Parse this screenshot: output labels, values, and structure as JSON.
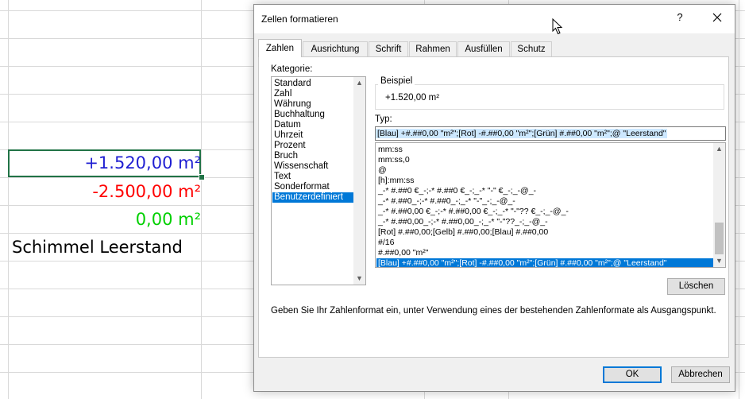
{
  "sheet": {
    "cells": [
      {
        "text": "+1.520,00 m²",
        "color": "#1f1fd2"
      },
      {
        "text": "-2.500,00 m²",
        "color": "#ff0000"
      },
      {
        "text": "0,00 m²",
        "color": "#00d000"
      },
      {
        "text": "Schimmel Leerstand",
        "color": "#000000"
      }
    ],
    "gridline_color": "#d9d9d9",
    "active_cell_border": "#217346"
  },
  "dialog": {
    "title": "Zellen formatieren",
    "help": "?",
    "tabs": [
      "Zahlen",
      "Ausrichtung",
      "Schrift",
      "Rahmen",
      "Ausfüllen",
      "Schutz"
    ],
    "active_tab": "Zahlen",
    "kategorie_label": "Kategorie:",
    "categories": [
      "Standard",
      "Zahl",
      "Währung",
      "Buchhaltung",
      "Datum",
      "Uhrzeit",
      "Prozent",
      "Bruch",
      "Wissenschaft",
      "Text",
      "Sonderformat",
      "Benutzerdefiniert"
    ],
    "selected_category": "Benutzerdefiniert",
    "beispiel_label": "Beispiel",
    "beispiel_value": "+1.520,00 m²",
    "typ_label": "Typ:",
    "typ_value": "[Blau] +#.##0,00 \"m²\";[Rot] -#.##0,00 \"m²\";[Grün] #.##0,00 \"m²\";@ \"Leerstand\"",
    "formats": [
      "mm:ss",
      "mm:ss,0",
      "@",
      "[h]:mm:ss",
      "_-* #.##0 €_-;-* #.##0 €_-;_-* \"-\" €_-;_-@_-",
      "_-* #.##0_-;-* #.##0_-;_-* \"-\"_-;_-@_-",
      "_-* #.##0,00 €_-;-* #.##0,00 €_-;_-* \"-\"?? €_-;_-@_-",
      "_-* #.##0,00_-;-* #.##0,00_-;_-* \"-\"??_-;_-@_-",
      "[Rot] #.##0,00;[Gelb] #.##0,00;[Blau] #.##0,00",
      "#/16",
      "#.##0,00 \"m²\"",
      "[Blau] +#.##0,00 \"m²\";[Rot] -#.##0,00 \"m²\";[Grün] #.##0,00 \"m²\";@ \"Leerstand\""
    ],
    "selected_format_index": 11,
    "delete_button": "Löschen",
    "hint": "Geben Sie Ihr Zahlenformat ein, unter Verwendung eines der bestehenden Zahlenformate als Ausgangspunkt.",
    "ok_button": "OK",
    "cancel_button": "Abbrechen",
    "accent_color": "#0078d7"
  }
}
